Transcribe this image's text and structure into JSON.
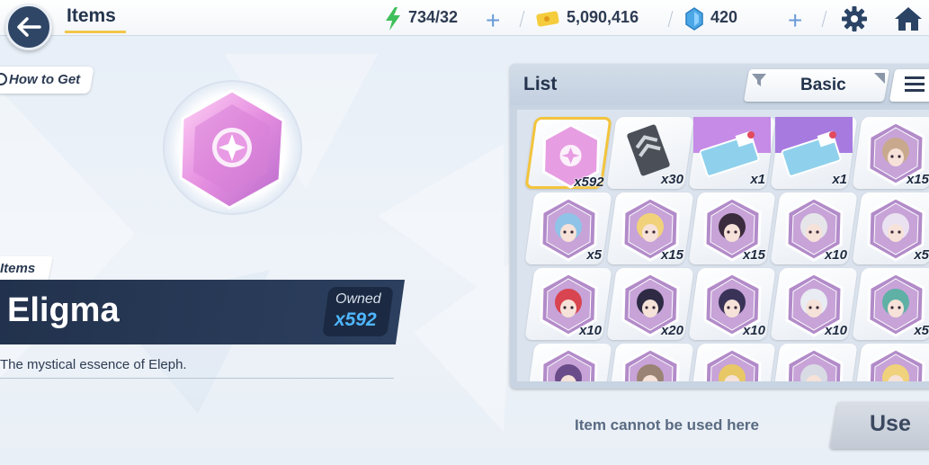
{
  "header": {
    "title": "Items",
    "stamina": "734/32",
    "gold": "5,090,416",
    "gems": "420"
  },
  "left": {
    "how_to_get": "How to Get",
    "category_tag": "Items",
    "item_name": "Eligma",
    "owned_label": "Owned",
    "owned_value": "x592",
    "description": "The mystical essence of Eleph."
  },
  "list": {
    "title": "List",
    "sort_label": "Basic",
    "items": [
      {
        "qty": "x592",
        "kind": "eligma"
      },
      {
        "qty": "x30",
        "kind": "material"
      },
      {
        "qty": "x1",
        "kind": "ticket-1"
      },
      {
        "qty": "x1",
        "kind": "ticket-10"
      },
      {
        "qty": "x15",
        "kind": "portrait",
        "color": "#c9a98e"
      },
      {
        "qty": "x5",
        "kind": "portrait",
        "color": "#8fc3e8"
      },
      {
        "qty": "x15",
        "kind": "portrait",
        "color": "#f1d27a"
      },
      {
        "qty": "x15",
        "kind": "portrait",
        "color": "#3b2c3d"
      },
      {
        "qty": "x10",
        "kind": "portrait",
        "color": "#e6e6ea"
      },
      {
        "qty": "x5",
        "kind": "portrait",
        "color": "#ebe2f1"
      },
      {
        "qty": "x10",
        "kind": "portrait",
        "color": "#d8444f"
      },
      {
        "qty": "x20",
        "kind": "portrait",
        "color": "#2e2a44"
      },
      {
        "qty": "x10",
        "kind": "portrait",
        "color": "#3a3358"
      },
      {
        "qty": "x10",
        "kind": "portrait",
        "color": "#e9ecf2"
      },
      {
        "qty": "x5",
        "kind": "portrait",
        "color": "#5fb0a5"
      },
      {
        "qty": "",
        "kind": "portrait",
        "color": "#6a4c8a"
      },
      {
        "qty": "",
        "kind": "portrait",
        "color": "#9a8374"
      },
      {
        "qty": "",
        "kind": "portrait",
        "color": "#e8c766"
      },
      {
        "qty": "",
        "kind": "portrait",
        "color": "#d9dbe4"
      },
      {
        "qty": "",
        "kind": "portrait",
        "color": "#f0d27c"
      }
    ]
  },
  "footer": {
    "status": "Item cannot be used here",
    "use_label": "Use"
  },
  "colors": {
    "accent_yellow": "#f3c43c",
    "navy": "#22324d",
    "owned_blue": "#4fb6ff"
  }
}
